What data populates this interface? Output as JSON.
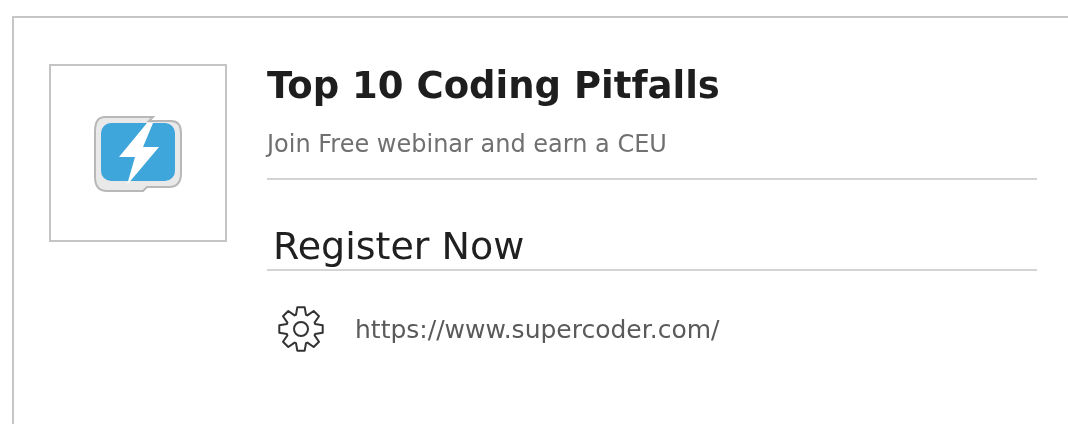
{
  "title": "Top 10 Coding Pitfalls",
  "subtitle": "Join Free webinar and earn a CEU",
  "action": "Register Now",
  "url": "https://www.supercoder.com/"
}
